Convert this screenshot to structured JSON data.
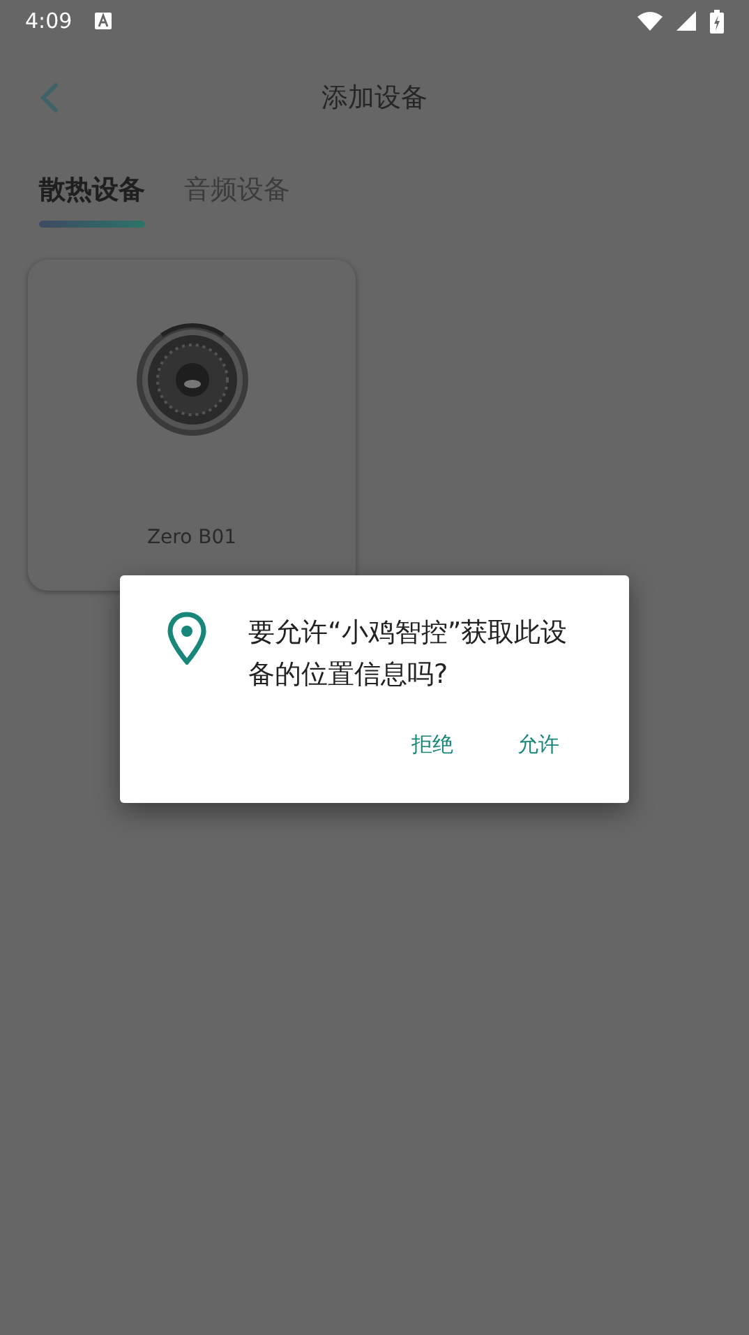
{
  "status_bar": {
    "time": "4:09"
  },
  "header": {
    "title": "添加设备"
  },
  "tabs": [
    {
      "label": "散热设备",
      "selected": true
    },
    {
      "label": "音频设备",
      "selected": false
    }
  ],
  "devices": [
    {
      "name": "Zero B01"
    }
  ],
  "dialog": {
    "message": "要允许“小鸡智控”获取此设备的位置信息吗?",
    "buttons": [
      {
        "label": "拒绝"
      },
      {
        "label": "允许"
      }
    ]
  }
}
